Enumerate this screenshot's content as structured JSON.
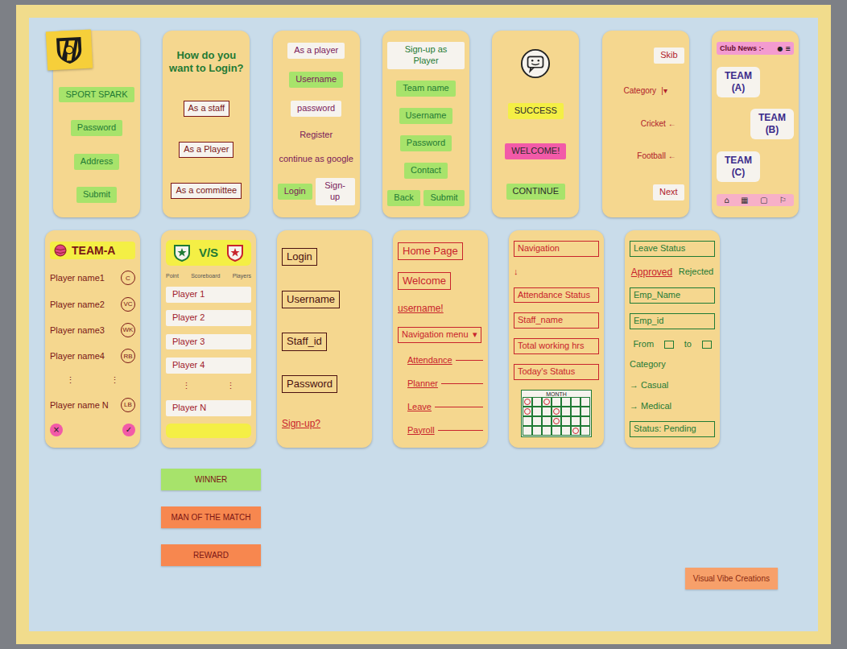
{
  "poster": {
    "rows": [
      [
        {
          "color": "#1f7a34",
          "items": [
            {
              "kind": "logo"
            },
            {
              "kind": "chip",
              "text": "SPORT SPARK",
              "color": "#a7e36b"
            },
            {
              "kind": "chip",
              "text": "Password",
              "color": "#a7e36b"
            },
            {
              "kind": "chip",
              "text": "Address",
              "color": "#a7e36b"
            },
            {
              "kind": "chip",
              "text": "Submit",
              "color": "#a7e36b"
            }
          ]
        },
        {
          "color": "#7a1616",
          "items": [
            {
              "kind": "title",
              "text": "How do you want to Login?"
            },
            {
              "kind": "box",
              "text": "As a staff",
              "color": "#f6f3ee"
            },
            {
              "kind": "box",
              "text": "As a Player",
              "color": "#f6f3ee"
            },
            {
              "kind": "box",
              "text": "As a committee",
              "color": "#f6f3ee"
            }
          ]
        },
        {
          "color": "#7a1a5a",
          "items": [
            {
              "kind": "chip",
              "text": "As a player",
              "color": "#f6f3ee"
            },
            {
              "kind": "chip",
              "text": "Username",
              "color": "#a7e36b"
            },
            {
              "kind": "chip",
              "text": "password",
              "color": "#f6f3ee"
            },
            {
              "kind": "text",
              "text": "Register"
            },
            {
              "kind": "text",
              "text": "continue as google"
            },
            {
              "kind": "row",
              "items": [
                {
                  "kind": "chip",
                  "text": "Login",
                  "color": "#a7e36b"
                },
                {
                  "kind": "chip",
                  "text": "Sign-up",
                  "color": "#f6f3ee"
                }
              ]
            }
          ]
        },
        {
          "color": "#1f7a34",
          "items": [
            {
              "kind": "chip",
              "text": "Sign-up as Player",
              "color": "#f6f3ee"
            },
            {
              "kind": "chip",
              "text": "Team name",
              "color": "#a7e36b"
            },
            {
              "kind": "chip",
              "text": "Username",
              "color": "#a7e36b"
            },
            {
              "kind": "chip",
              "text": "Password",
              "color": "#a7e36b"
            },
            {
              "kind": "chip",
              "text": "Contact",
              "color": "#a7e36b"
            },
            {
              "kind": "row",
              "items": [
                {
                  "kind": "chip",
                  "text": "Back",
                  "color": "#a7e36b"
                },
                {
                  "kind": "chip",
                  "text": "Submit",
                  "color": "#a7e36b"
                }
              ]
            }
          ]
        },
        {
          "color": "#2a2a2a",
          "items": [
            {
              "kind": "chat"
            },
            {
              "kind": "chip",
              "text": "SUCCESS",
              "color": "#f4ef45"
            },
            {
              "kind": "chip",
              "text": "WELCOME!",
              "color": "#f25aa8"
            },
            {
              "kind": "chip",
              "text": "CONTINUE",
              "color": "#a7e36b"
            }
          ]
        },
        {
          "color": "#b0202a",
          "items": [
            {
              "kind": "chip",
              "text": "Skib",
              "color": "#f6f3ee",
              "align": "right"
            },
            {
              "kind": "select",
              "text": "Category",
              "icon": "|▾"
            },
            {
              "kind": "option",
              "text": "Cricket ←"
            },
            {
              "kind": "option",
              "text": "Football ←"
            },
            {
              "kind": "chip",
              "text": "Next",
              "color": "#f6f3ee",
              "align": "right"
            }
          ]
        },
        {
          "color": "#3a2a8a",
          "items": [
            {
              "kind": "header",
              "text": "Club News :-",
              "icon": "● ≡",
              "color": "#f39bd0"
            },
            {
              "kind": "team",
              "text": "TEAM (A)",
              "align": "left"
            },
            {
              "kind": "team",
              "text": "TEAM (B)",
              "align": "right"
            },
            {
              "kind": "team",
              "text": "TEAM (C)",
              "align": "left"
            },
            {
              "kind": "nav",
              "color": "#f7b0c8",
              "items": [
                "⌂",
                "▦",
                "▢",
                "⚐"
              ]
            }
          ]
        }
      ],
      [
        {
          "color": "#7a1616",
          "items": [
            {
              "kind": "team-header",
              "text": "TEAM-A",
              "color": "#f4ef45"
            },
            {
              "kind": "player",
              "text": "Player name1",
              "role": "C"
            },
            {
              "kind": "player",
              "text": "Player name2",
              "role": "VC"
            },
            {
              "kind": "player",
              "text": "Player name3",
              "role": "WK"
            },
            {
              "kind": "player",
              "text": "Player name4",
              "role": "RB"
            },
            {
              "kind": "row",
              "items": [
                {
                  "kind": "text",
                  "text": "⋮"
                },
                {
                  "kind": "text",
                  "text": "⋮"
                }
              ]
            },
            {
              "kind": "player",
              "text": "Player name N",
              "role": "LB"
            },
            {
              "kind": "actions",
              "color": "#f25aa8",
              "items": [
                "×",
                "✓"
              ]
            }
          ]
        },
        {
          "color": "#a01a2a",
          "items": [
            {
              "kind": "vs",
              "text": "V/S",
              "color": "#f4ef45"
            },
            {
              "kind": "tabs",
              "items": [
                "Point",
                "Scoreboard",
                "Players"
              ]
            },
            {
              "kind": "chip",
              "text": "Player 1",
              "color": "#f6f3ee"
            },
            {
              "kind": "chip",
              "text": "Player 2",
              "color": "#f6f3ee"
            },
            {
              "kind": "chip",
              "text": "Player 3",
              "color": "#f6f3ee"
            },
            {
              "kind": "chip",
              "text": "Player 4",
              "color": "#f6f3ee"
            },
            {
              "kind": "row",
              "items": [
                {
                  "kind": "text",
                  "text": "⋮"
                },
                {
                  "kind": "text",
                  "text": "⋮"
                }
              ]
            },
            {
              "kind": "chip",
              "text": "Player N",
              "color": "#f6f3ee"
            },
            {
              "kind": "bar",
              "color": "#f4ef45"
            }
          ]
        },
        {
          "color": "#4a1010",
          "items": [
            {
              "kind": "box",
              "text": "Login"
            },
            {
              "kind": "box",
              "text": "Username"
            },
            {
              "kind": "box",
              "text": "Staff_id"
            },
            {
              "kind": "box",
              "text": "Password"
            },
            {
              "kind": "link",
              "text": "Sign-up?"
            }
          ]
        },
        {
          "color": "#c8232c",
          "items": [
            {
              "kind": "box",
              "text": "Home Page"
            },
            {
              "kind": "box",
              "text": "Welcome"
            },
            {
              "kind": "link",
              "text": "username!"
            },
            {
              "kind": "menu",
              "text": "Navigation menu",
              "icon": "▾"
            },
            {
              "kind": "menu-item",
              "text": "Attendance"
            },
            {
              "kind": "menu-item",
              "text": "Planner"
            },
            {
              "kind": "menu-item",
              "text": "Leave"
            },
            {
              "kind": "menu-item",
              "text": "Payroll"
            }
          ]
        },
        {
          "color": "#c8232c",
          "items": [
            {
              "kind": "cell",
              "text": "Navigation"
            },
            {
              "kind": "text",
              "text": "↓"
            },
            {
              "kind": "cell",
              "text": "Attendance Status"
            },
            {
              "kind": "cell",
              "text": "Staff_name"
            },
            {
              "kind": "cell",
              "text": "Total working hrs"
            },
            {
              "kind": "cell",
              "text": "Today's Status"
            },
            {
              "kind": "calendar",
              "text": "MONTH",
              "marks": [
                true,
                false,
                true,
                false,
                false,
                false,
                false,
                true,
                false,
                false,
                true,
                false,
                false,
                false,
                false,
                false,
                false,
                true,
                false,
                false,
                false,
                false,
                false,
                false,
                false,
                false,
                true,
                false
              ]
            }
          ]
        },
        {
          "color": "#1f7a34",
          "items": [
            {
              "kind": "cell",
              "text": "Leave Status"
            },
            {
              "kind": "row",
              "items": [
                {
                  "kind": "link",
                  "text": "Approved"
                },
                {
                  "kind": "text",
                  "text": "Rejected"
                }
              ]
            },
            {
              "kind": "cell",
              "text": "Emp_Name"
            },
            {
              "kind": "cell",
              "text": "Emp_id"
            },
            {
              "kind": "row",
              "items": [
                {
                  "kind": "text",
                  "text": "From"
                },
                {
                  "kind": "checkbox"
                },
                {
                  "kind": "text",
                  "text": "to"
                },
                {
                  "kind": "checkbox"
                }
              ]
            },
            {
              "kind": "text",
              "text": "Category"
            },
            {
              "kind": "text",
              "text": "→ Casual"
            },
            {
              "kind": "text",
              "text": "→ Medical"
            },
            {
              "kind": "cell",
              "text": "Status: Pending"
            }
          ]
        }
      ]
    ],
    "labels": [
      {
        "text": "WINNER",
        "color": "#a7e36b"
      },
      {
        "text": "MAN OF THE MATCH",
        "color": "#f7874f"
      },
      {
        "text": "REWARD",
        "color": "#f7874f"
      }
    ],
    "signature": {
      "text": "Visual Vibe Creations",
      "color": "#f7a06a"
    }
  }
}
